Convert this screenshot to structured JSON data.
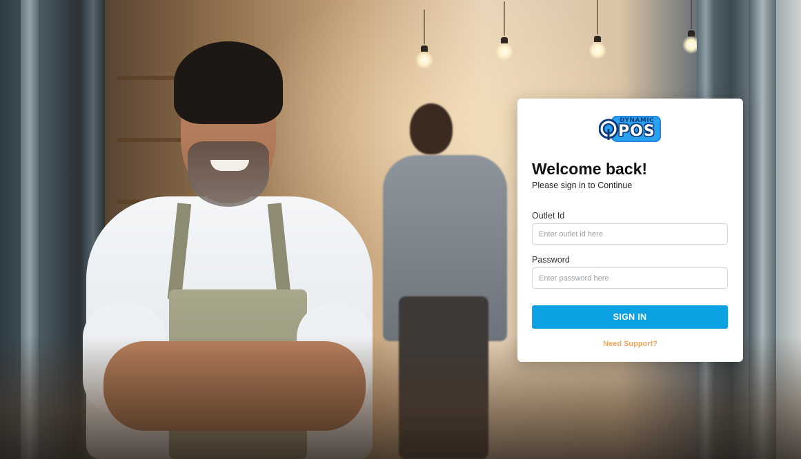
{
  "brand": {
    "logo_top_text": "DYNAMIC",
    "logo_main_text": "POS",
    "logo_color": "#0d3a7a",
    "logo_accent": "#1e88e5"
  },
  "login": {
    "heading": "Welcome back!",
    "subheading": "Please sign in to Continue",
    "outlet_label": "Outlet Id",
    "outlet_placeholder": "Enter outlet id here",
    "outlet_value": "",
    "password_label": "Password",
    "password_placeholder": "Enter password here",
    "password_value": "",
    "submit_label": "SIGN IN",
    "support_link": "Need Support?"
  },
  "colors": {
    "primary_button": "#0ba1e2",
    "support_link": "#f5a65b",
    "card_bg": "#ffffff"
  },
  "background": {
    "icon": "cafe-owner-photo"
  }
}
